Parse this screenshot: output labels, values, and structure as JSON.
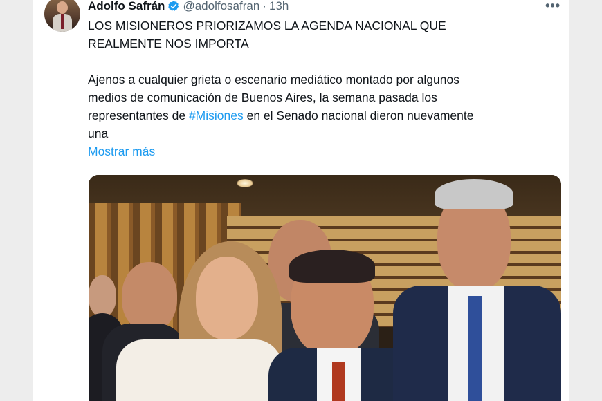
{
  "tweet": {
    "author_name": "Adolfo Safrán",
    "handle": "@adolfosafran",
    "separator": "·",
    "time": "13h",
    "more_icon": "more-horizontal-icon",
    "verified_icon": "verified-badge-icon",
    "headline_line1": "LOS MISIONEROS PRIORIZAMOS LA AGENDA NACIONAL QUE",
    "headline_line2": "REALMENTE NOS IMPORTA",
    "body_line1": "Ajenos a cualquier grieta o escenario mediático montado por algunos",
    "body_line2": "medios de comunicación de Buenos Aires, la semana pasada los",
    "body_line3_before": "representantes de ",
    "body_line3_hashtag": "#Misiones",
    "body_line3_after": " en el Senado nacional dieron nuevamente",
    "body_line4": "una",
    "show_more": "Mostrar más"
  },
  "colors": {
    "link": "#1d9bf0",
    "text": "#0f1419",
    "secondary": "#536471",
    "background": "#ededed"
  }
}
